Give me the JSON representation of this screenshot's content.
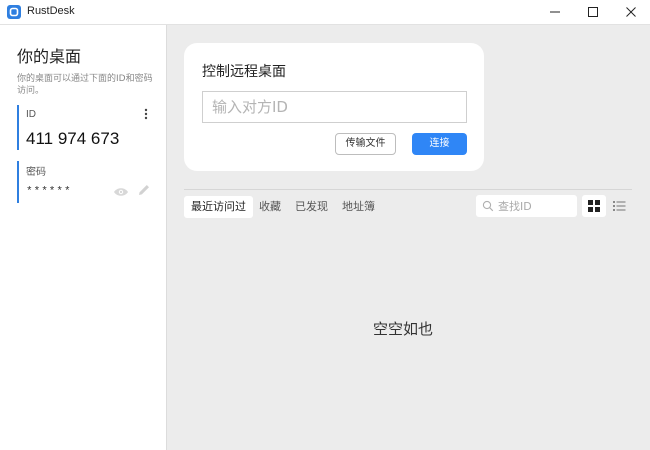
{
  "window": {
    "title": "RustDesk",
    "accent": "#2f7fe0"
  },
  "left_panel": {
    "title": "你的桌面",
    "subtitle": "你的桌面可以通过下面的ID和密码访问。",
    "id_label": "ID",
    "id_value": "411 974 673",
    "password_label": "密码",
    "password_value": "******"
  },
  "control_card": {
    "title": "控制远程桌面",
    "input_placeholder": "输入对方ID",
    "input_value": "",
    "transfer_button": "传输文件",
    "connect_button": "连接"
  },
  "tabs": [
    {
      "label": "最近访问过",
      "active": true
    },
    {
      "label": "收藏",
      "active": false
    },
    {
      "label": "已发现",
      "active": false
    },
    {
      "label": "地址簿",
      "active": false
    }
  ],
  "search": {
    "placeholder": "查找ID"
  },
  "empty_message": "空空如也",
  "icons": [
    "app-logo-icon",
    "minimize-icon",
    "maximize-icon",
    "close-icon",
    "more-vertical-icon",
    "eye-icon",
    "edit-icon",
    "search-icon",
    "grid-view-icon",
    "list-view-icon"
  ]
}
